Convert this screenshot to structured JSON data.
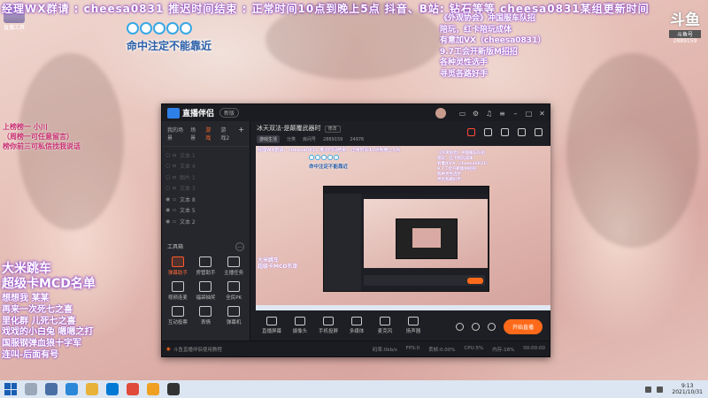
{
  "overlay": {
    "ticker": "经理WX群请 : cheesa0831 推迟时间结束 : 正常时间10点到晚上5点 抖音、B站: 钻石等等 cheesa0831某组更新时间",
    "stream_logo_label": "直播工具",
    "shot_message": "命中注定不能靠近",
    "right_info": [
      "《外观协会》冲国服车队招",
      "陪玩，红卡陪玩成体",
      "有意加VX（cheesa0831）",
      "9.7工会开新版M招招",
      "各种灵性选手",
      "寻觅各路好手"
    ],
    "brand_logo": "斗鱼",
    "brand_tag": "斗鱼号",
    "brand_num": "2889159",
    "left_list": [
      "上榜榜一 小川",
      "（周榜一可任意留言）",
      "榜你前三可私信找我说话"
    ],
    "car_title": [
      "大米跳车",
      "超级卡MCD名单"
    ],
    "car_list": [
      "想想我 某某",
      "再来一次死七之喜",
      "里化群 儿死七之喜",
      "戏戏的小白兔 嗯嗯之打",
      "国服钢弹血狼十字军",
      "连叫-后面有号"
    ]
  },
  "app": {
    "name": "直播伴侣",
    "version": "新版",
    "side_tabs": [
      "我的场景",
      "场景",
      "游戏",
      "游戏2"
    ],
    "active_side_tab": "游戏",
    "sources": [
      {
        "label": "文本 1",
        "dim": true
      },
      {
        "label": "文本 4",
        "dim": true
      },
      {
        "label": "图片 1",
        "dim": true
      },
      {
        "label": "文本 3",
        "dim": false
      },
      {
        "label": "文本 8",
        "dim": false
      },
      {
        "label": "文本 5",
        "dim": false
      },
      {
        "label": "文本 2",
        "dim": false
      }
    ],
    "tools_heading": "工具箱",
    "tools_more": "…",
    "tools": [
      {
        "label": "弹幕助手",
        "hot": true
      },
      {
        "label": "房管助手",
        "hot": false
      },
      {
        "label": "主播任务",
        "hot": false
      },
      {
        "label": "视频连麦",
        "hot": false
      },
      {
        "label": "福袋抽奖",
        "hot": false
      },
      {
        "label": "全民PK",
        "hot": false
      },
      {
        "label": "互动投票",
        "hot": false
      },
      {
        "label": "表情",
        "hot": false
      },
      {
        "label": "弹幕机",
        "hot": false
      }
    ],
    "room_title": "冰天双法-是颠覆武器时",
    "edit_label": "修改",
    "room_meta": {
      "category": "游戏生活",
      "category2": "分类",
      "id_label": "房间号",
      "id_value": "2889159",
      "fans_value": "24976"
    },
    "preview": {
      "ticker": "经理WX群请 : cheesa0831 推迟时间结束 : 正常时间10点到晚上5点",
      "message": "命中注定不能靠近",
      "right_info": [
        "《外观协会》冲国服车队招",
        "陪玩，红卡陪玩成体",
        "有意加VX（cheesa0831）",
        "9.7工会开新版M招招",
        "各种灵性选手",
        "寻觅各路好手"
      ],
      "left_title": [
        "大米跳车",
        "超级卡MCD名单"
      ]
    },
    "controls": [
      "直播屏幕",
      "摄像头",
      "手机投屏",
      "多媒体",
      "麦克风",
      "扬声器"
    ],
    "go_live": "开始直播",
    "status_notice": "斗鱼直播伴侣使用教程",
    "status_stats": [
      "码率:0kb/s",
      "FPS:0",
      "丢帧:0.00%",
      "CPU:5%",
      "内存:18%",
      "00:00:00"
    ]
  },
  "taskbar": {
    "time": "9:13",
    "date": "2021/10/31"
  },
  "colors": {
    "accent": "#ff6a1a",
    "app_bg": "#1e1f24",
    "overlay_purple": "#8a3fd0",
    "message_blue": "#2b5fa8"
  }
}
